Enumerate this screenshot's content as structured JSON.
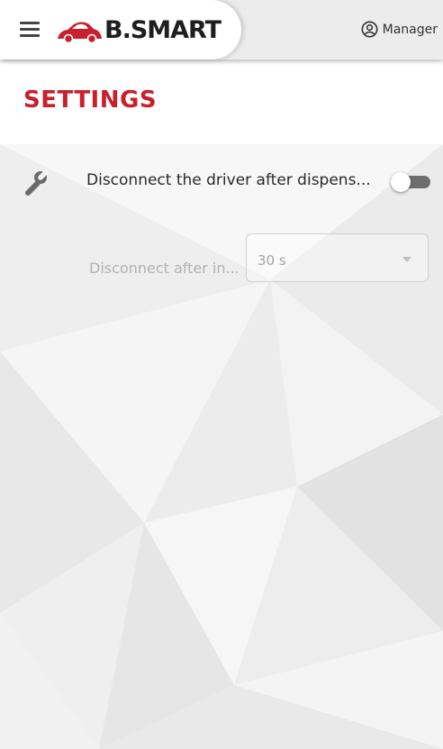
{
  "header": {
    "brand_text": "B.SMART",
    "user_label": "Manager",
    "menu_icon": "hamburger-menu-icon",
    "user_icon": "account-circle-icon"
  },
  "page": {
    "title": "SETTINGS"
  },
  "settings": {
    "disconnect_driver": {
      "icon": "wrench-icon",
      "label": "Disconnect the driver after dispens...",
      "enabled": false
    },
    "disconnect_delay": {
      "label": "Disconnect after in...",
      "selected_value": "30 s",
      "disabled": true
    }
  },
  "colors": {
    "brand_red": "#c8202c",
    "header_bg": "#ececec",
    "text_dark": "#2a2a2a",
    "text_disabled": "#b2b2b2",
    "toggle_off_track": "#6e6e6e"
  }
}
